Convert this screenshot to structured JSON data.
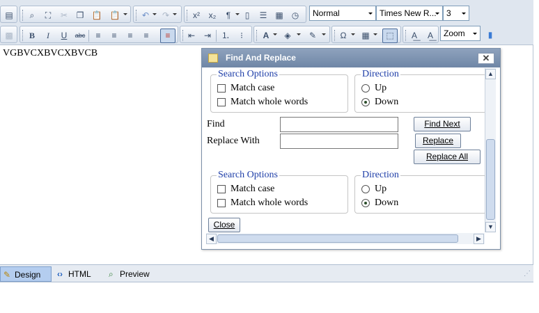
{
  "toolbar": {
    "row1_icons": [
      "print-icon",
      "find-icon",
      "select-all-icon",
      "cut-icon",
      "copy-icon",
      "paste-icon",
      "paste-special-icon",
      "undo-icon",
      "redo-icon",
      "superscript-icon",
      "subscript-icon",
      "paragraph-icon",
      "insert-page-icon",
      "horizontal-rule-icon",
      "insert-date-icon",
      "insert-time-icon"
    ],
    "format_select": "Normal",
    "font_select": "Times New R...",
    "size_select": "3",
    "zoom_select": "Zoom"
  },
  "editor": {
    "content": "VGBVCXBVCXBVCB"
  },
  "dialog": {
    "title": "Find And Replace",
    "close_symbol": "✕",
    "search_options_legend": "Search Options",
    "match_case_label": "Match case",
    "match_whole_words_label": "Match whole words",
    "direction_legend": "Direction",
    "up_label": "Up",
    "down_label": "Down",
    "find_label": "Find",
    "replace_with_label": "Replace With",
    "find_value": "",
    "replace_value": "",
    "find_next_button": "Find Next",
    "replace_button": "Replace",
    "replace_all_button": "Replace All",
    "close_button": "Close",
    "selected_direction": "Down"
  },
  "bottom_tabs": {
    "design": "Design",
    "html": "HTML",
    "preview": "Preview",
    "active": "Design"
  },
  "colors": {
    "toolbar_bg": "#dfe6ef",
    "dialog_title_bg": "#7d93b2",
    "legend_text": "#1e3ea8",
    "active_tab_bg": "#b4cdef"
  }
}
